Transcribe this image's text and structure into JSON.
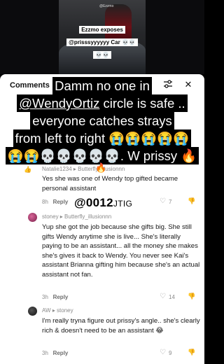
{
  "video": {
    "watermark": "@Ezzmo",
    "caption_lines": [
      "Ezzmo exposes",
      "@prisssyyyyyy Car 💀💀",
      "💀💀"
    ]
  },
  "sheet": {
    "title": "Comments",
    "filter_icon": "sliders-icon",
    "close_icon": "close-icon"
  },
  "overlay": {
    "line1": "Damm no one in",
    "line2_mention": "@WendyOrtiz",
    "line2_rest": " circle is safe ..",
    "line3": "everyone catches  strays",
    "line4": "from left to right 😭😭😭😭😭",
    "line5": "😭😭💀💀💀💀💀. W prissy 🔥",
    "fire": "🔥"
  },
  "tag": {
    "text": "@0012",
    "suffix": "JTIG"
  },
  "comments": [
    {
      "author": "Natalie1234 ▸ Butterfly_illusionnn",
      "text": "Yes she was one of Wendy top gifted became personal assistant",
      "time": "8h",
      "reply": "Reply",
      "likes": "7"
    },
    {
      "author": "stoney ▸ Butterfly_illusionnn",
      "text": "Yup she got the job because she gifts big. She still gifts Wendy anytime she is live... She's literally paying to be an assistant... all the money she makes she's gives it back to Wendy. You never see Kai's assistant Brianna gifting him because she's an actual assistant not fan.",
      "time": "3h",
      "reply": "Reply",
      "likes": "14"
    },
    {
      "author": "AW ▸ stoney",
      "text": "I'm really tryna figure out prissy's angle.. she's clearly rich & doesn't need to be an assistant 😂",
      "time": "3h",
      "reply": "Reply",
      "likes": "9"
    }
  ],
  "colors": {
    "sheet_bg": "#ffffff",
    "overlay_bg": "#000000",
    "meta": "#8a8a8a"
  }
}
